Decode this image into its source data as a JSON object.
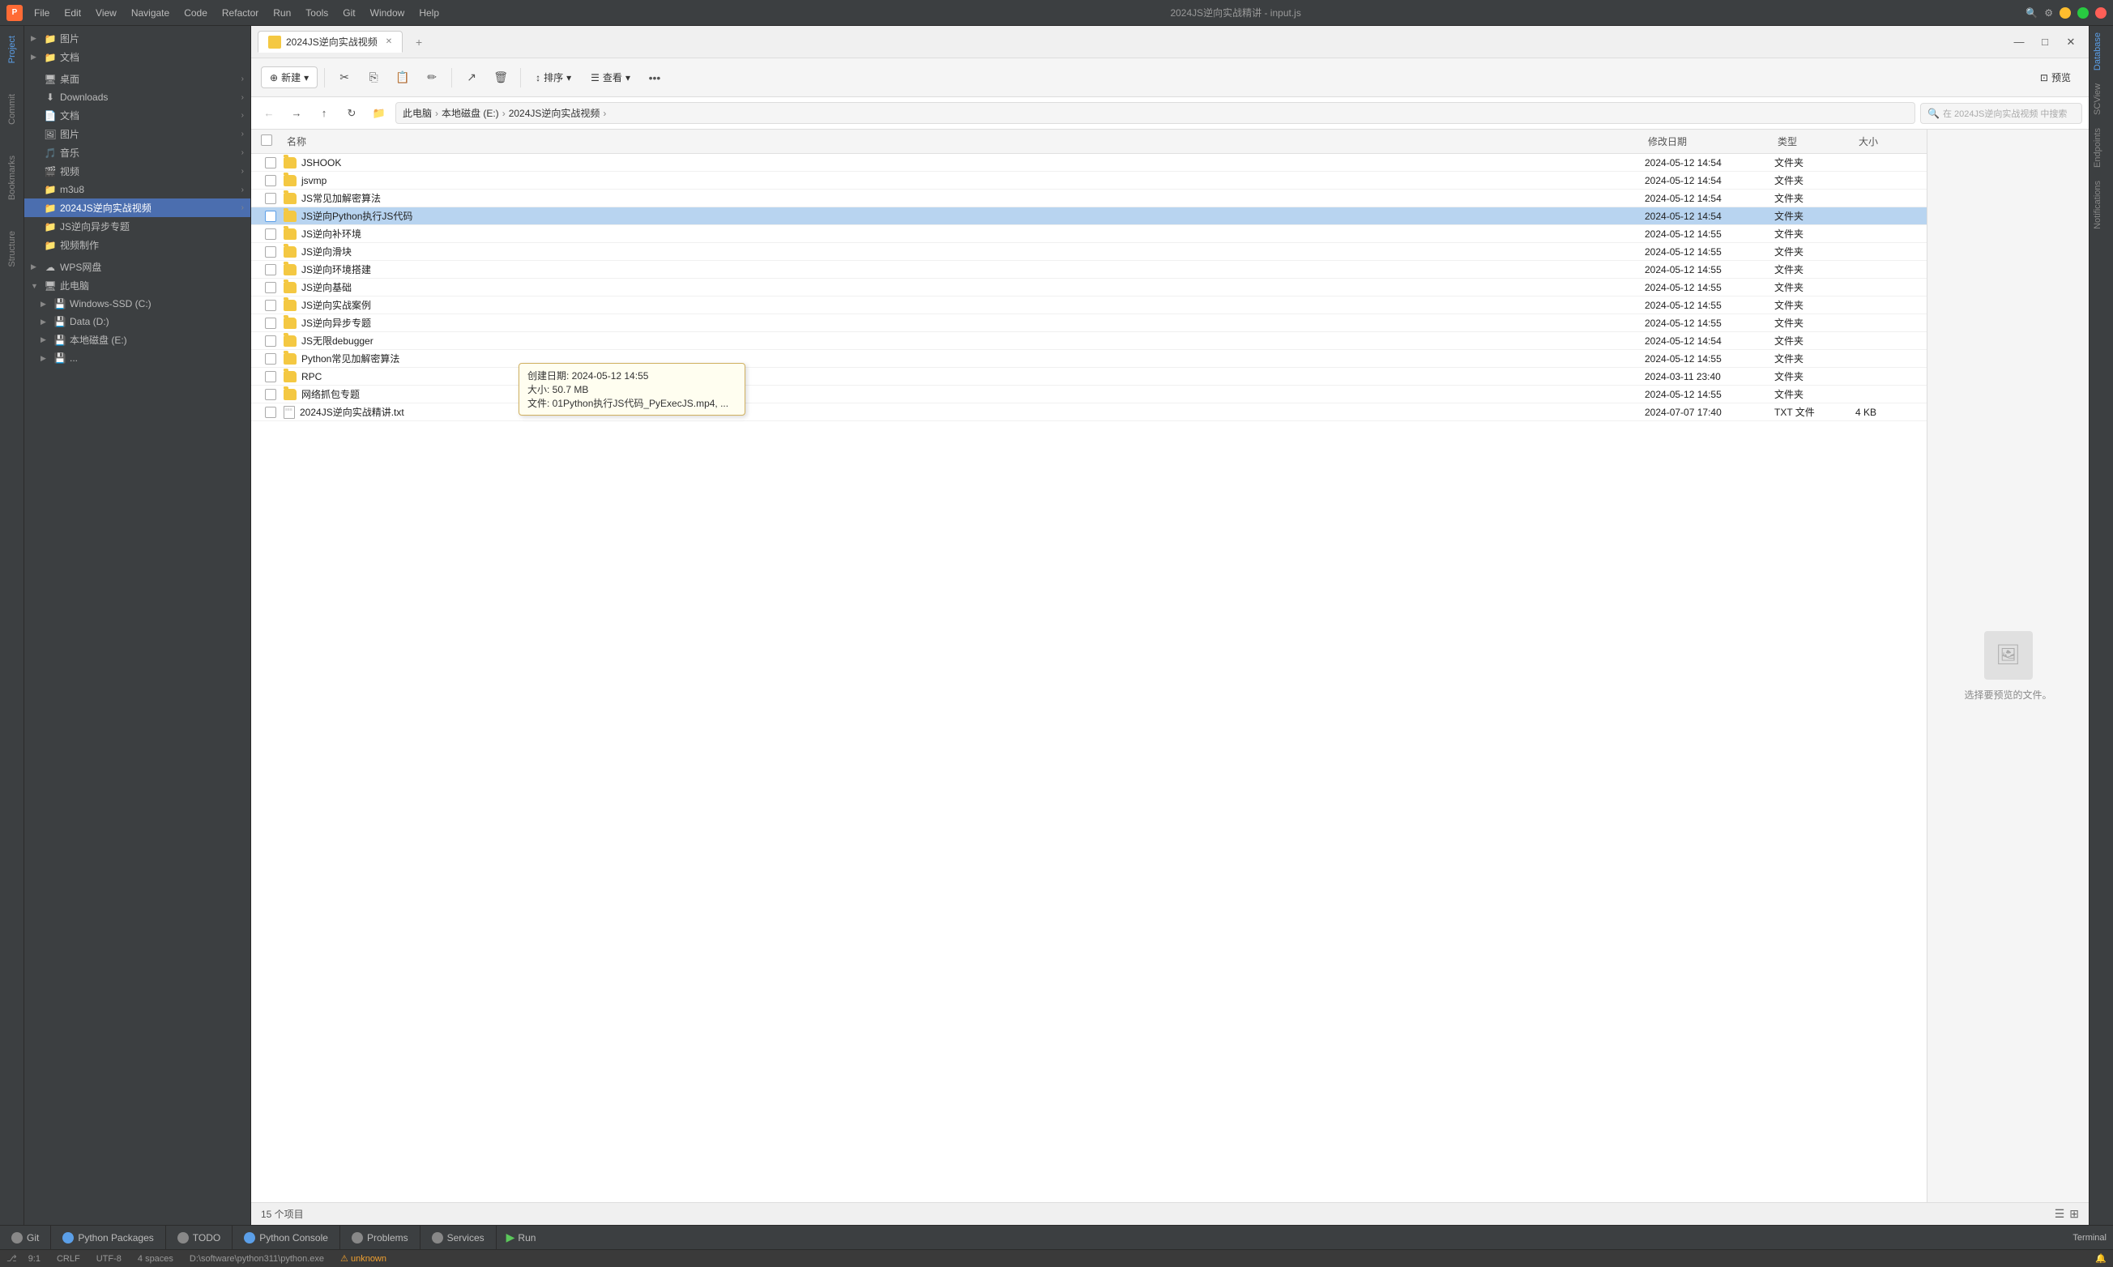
{
  "app": {
    "title": "2024JS逆向实战精讲 - input.js",
    "logo": "P",
    "menus": [
      "File",
      "Edit",
      "View",
      "Navigate",
      "Code",
      "Refactor",
      "Run",
      "Tools",
      "Git",
      "Window",
      "Help"
    ]
  },
  "file_manager": {
    "tab_title": "2024JS逆向实战视频",
    "breadcrumb": {
      "parts": [
        "此电脑",
        "本地磁盘 (E:)",
        "2024JS逆向实战视频"
      ]
    },
    "search_placeholder": "在 2024JS逆向实战视频 中搜索",
    "toolbar": {
      "new_label": "新建",
      "sort_label": "排序",
      "view_label": "查看",
      "preview_label": "预览"
    },
    "columns": [
      "",
      "名称",
      "修改日期",
      "类型",
      "大小"
    ],
    "files": [
      {
        "name": "JSHOOK",
        "date": "2024-05-12 14:54",
        "type": "文件夹",
        "size": ""
      },
      {
        "name": "jsvmp",
        "date": "2024-05-12 14:54",
        "type": "文件夹",
        "size": ""
      },
      {
        "name": "JS常见加解密算法",
        "date": "2024-05-12 14:54",
        "type": "文件夹",
        "size": ""
      },
      {
        "name": "JS逆向Python执行JS代码",
        "date": "2024-05-12 14:54",
        "type": "文件夹",
        "size": "",
        "highlighted": true
      },
      {
        "name": "JS逆向补环境",
        "date": "2024-05-12 14:55",
        "type": "文件夹",
        "size": ""
      },
      {
        "name": "JS逆向滑块",
        "date": "2024-05-12 14:55",
        "type": "文件夹",
        "size": ""
      },
      {
        "name": "JS逆向环境搭建",
        "date": "2024-05-12 14:55",
        "type": "文件夹",
        "size": ""
      },
      {
        "name": "JS逆向基础",
        "date": "2024-05-12 14:55",
        "type": "文件夹",
        "size": ""
      },
      {
        "name": "JS逆向实战案例",
        "date": "2024-05-12 14:55",
        "type": "文件夹",
        "size": ""
      },
      {
        "name": "JS逆向异步专题",
        "date": "2024-05-12 14:55",
        "type": "文件夹",
        "size": ""
      },
      {
        "name": "JS无限debugger",
        "date": "2024-05-12 14:54",
        "type": "文件夹",
        "size": ""
      },
      {
        "name": "Python常见加解密算法",
        "date": "2024-05-12 14:55",
        "type": "文件夹",
        "size": ""
      },
      {
        "name": "RPC",
        "date": "2024-03-11 23:40",
        "type": "文件夹",
        "size": ""
      },
      {
        "name": "网络抓包专题",
        "date": "2024-05-12 14:55",
        "type": "文件夹",
        "size": ""
      },
      {
        "name": "2024JS逆向实战精讲.txt",
        "date": "2024-07-07 17:40",
        "type": "TXT 文件",
        "size": "4 KB"
      }
    ],
    "tooltip": {
      "line1": "创建日期: 2024-05-12 14:55",
      "line2": "大小: 50.7 MB",
      "line3": "文件: 01Python执行JS代码_PyExecJS.mp4, ..."
    },
    "status": "15 个项目",
    "preview_text": "选择要预览的文件。"
  },
  "left_tree": {
    "items": [
      {
        "indent": 0,
        "icon": "▶",
        "type": "folder",
        "label": "图片",
        "pin": false
      },
      {
        "indent": 0,
        "icon": "▶",
        "type": "folder",
        "label": "文档",
        "pin": false
      },
      {
        "indent": 0,
        "icon": "🖥",
        "type": "desktop",
        "label": "桌面",
        "pin": true
      },
      {
        "indent": 0,
        "icon": "⬇",
        "type": "download",
        "label": "Downloads",
        "pin": true
      },
      {
        "indent": 0,
        "icon": "📄",
        "type": "doc",
        "label": "文档",
        "pin": true
      },
      {
        "indent": 0,
        "icon": "🖼",
        "type": "image",
        "label": "图片",
        "pin": true
      },
      {
        "indent": 0,
        "icon": "🎵",
        "type": "music",
        "label": "音乐",
        "pin": true
      },
      {
        "indent": 0,
        "icon": "🎬",
        "type": "video",
        "label": "视频",
        "pin": true
      },
      {
        "indent": 0,
        "icon": "📁",
        "type": "folder",
        "label": "m3u8",
        "pin": true
      },
      {
        "indent": 0,
        "icon": "📁",
        "type": "folder",
        "label": "2024JS逆向实战视频",
        "pin": true,
        "selected": true
      },
      {
        "indent": 0,
        "icon": "📁",
        "type": "folder",
        "label": "JS逆向异步专题",
        "pin": false
      },
      {
        "indent": 0,
        "icon": "📁",
        "type": "folder",
        "label": "视频制作",
        "pin": false
      },
      {
        "indent": 0,
        "icon": "▶",
        "type": "folder",
        "label": "WPS网盘",
        "pin": false
      },
      {
        "indent": 0,
        "icon": "▼",
        "type": "folder",
        "label": "此电脑",
        "pin": false
      },
      {
        "indent": 1,
        "icon": "▶",
        "type": "drive",
        "label": "Windows-SSD (C:)",
        "pin": false
      },
      {
        "indent": 1,
        "icon": "▶",
        "type": "drive",
        "label": "Data (D:)",
        "pin": false
      },
      {
        "indent": 1,
        "icon": "▶",
        "type": "drive",
        "label": "本地磁盘 (E:)",
        "pin": false
      },
      {
        "indent": 1,
        "icon": "▶",
        "type": "drive",
        "label": "...",
        "pin": false
      }
    ]
  },
  "bottom_tabs": [
    {
      "label": "Git",
      "icon": "git",
      "active": false
    },
    {
      "label": "Python Packages",
      "icon": "py",
      "active": false
    },
    {
      "label": "TODO",
      "icon": "check",
      "active": false
    },
    {
      "label": "Python Console",
      "icon": "py",
      "active": false
    },
    {
      "label": "Problems",
      "icon": "warn",
      "active": false
    },
    {
      "label": "Services",
      "icon": "gear",
      "active": false
    },
    {
      "label": "Run",
      "icon": "run",
      "active": false
    }
  ],
  "ide_sidebar": {
    "panels": [
      "Project",
      "Commit",
      "Bookmarks",
      "Structure"
    ]
  },
  "right_panels": [
    "Database",
    "SCView",
    "Endpoints",
    "Notifications"
  ],
  "status_bar": {
    "line_col": "9:1",
    "line_ending": "CRLF",
    "encoding": "UTF-8",
    "indent": "4 spaces",
    "interpreter": "D:\\software\\python311\\python.exe",
    "warning": "⚠ unknown"
  }
}
